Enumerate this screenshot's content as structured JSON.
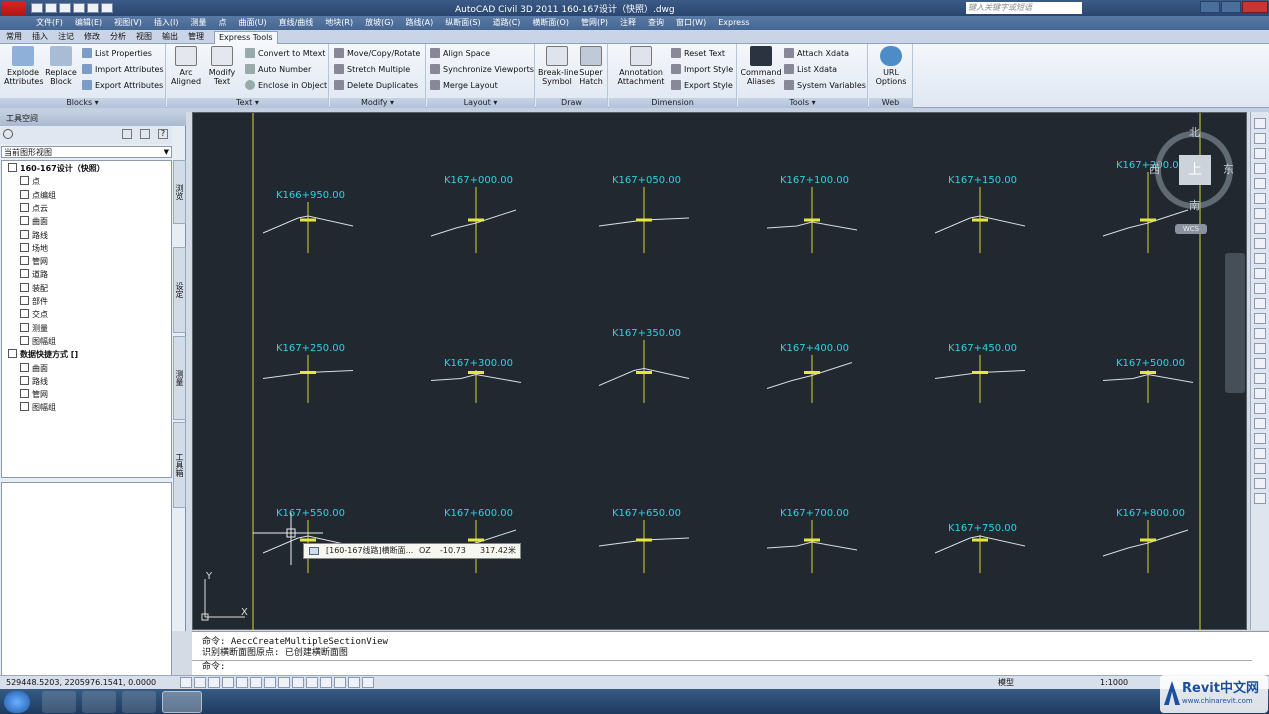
{
  "titlebar": {
    "title": "AutoCAD Civil 3D 2011    160-167设计（快照）.dwg",
    "search_placeholder": "键入关键字或短语"
  },
  "menubar": {
    "items": [
      "文件(F)",
      "编辑(E)",
      "视图(V)",
      "插入(I)",
      "测量",
      "点",
      "曲面(U)",
      "直线/曲线",
      "地块(R)",
      "放坡(G)",
      "路线(A)",
      "纵断面(S)",
      "道路(C)",
      "横断面(O)",
      "管网(P)",
      "注释",
      "查询",
      "窗口(W)",
      "Express"
    ]
  },
  "ribbon_tabs": {
    "items": [
      "常用",
      "插入",
      "注记",
      "修改",
      "分析",
      "视图",
      "输出",
      "管理",
      "Express Tools"
    ],
    "active": "Express Tools"
  },
  "ribbon": {
    "blocks": {
      "footer": "Blocks ▾",
      "explode": "Explode\nAttributes",
      "replace": "Replace\nBlock",
      "list_props": "List Properties",
      "import_attr": "Import Attributes",
      "export_attr": "Export Attributes"
    },
    "text": {
      "footer": "Text ▾",
      "arc": "Arc\nAligned",
      "modify": "Modify\nText",
      "convert": "Convert to Mtext",
      "auto_number": "Auto Number",
      "enclose": "Enclose in Object"
    },
    "modify": {
      "footer": "Modify ▾",
      "move_copy": "Move/Copy/Rotate",
      "stretch": "Stretch Multiple",
      "delete_dup": "Delete Duplicates"
    },
    "layout": {
      "footer": "Layout ▾",
      "align_space": "Align Space",
      "sync_viewports": "Synchronize Viewports",
      "merge_layout": "Merge Layout"
    },
    "draw": {
      "footer": "Draw",
      "breakline": "Break-line\nSymbol",
      "super_hatch": "Super\nHatch"
    },
    "dimension": {
      "footer": "Dimension",
      "annotation": "Annotation\nAttachment",
      "reset_text": "Reset Text",
      "import_style": "Import Style",
      "export_style": "Export Style"
    },
    "tools": {
      "footer": "Tools ▾",
      "cmd_aliases": "Command\nAliases",
      "attach_xdata": "Attach Xdata",
      "list_xdata": "List Xdata",
      "sys_vars": "System Variables"
    },
    "web": {
      "footer": "Web",
      "url_options": "URL\nOptions"
    }
  },
  "leftpanel": {
    "title": "工具空间",
    "dropdown": "当前图形视图",
    "tree": [
      {
        "label": "160-167设计（快照）",
        "level": 0
      },
      {
        "label": "点",
        "level": 1
      },
      {
        "label": "点编组",
        "level": 1
      },
      {
        "label": "点云",
        "level": 1
      },
      {
        "label": "曲面",
        "level": 1
      },
      {
        "label": "路线",
        "level": 1
      },
      {
        "label": "场地",
        "level": 1
      },
      {
        "label": "管网",
        "level": 1
      },
      {
        "label": "道路",
        "level": 1
      },
      {
        "label": "装配",
        "level": 1
      },
      {
        "label": "部件",
        "level": 1
      },
      {
        "label": "交点",
        "level": 1
      },
      {
        "label": "测量",
        "level": 1
      },
      {
        "label": "图幅组",
        "level": 1
      },
      {
        "label": "数据快捷方式 []",
        "level": 0
      },
      {
        "label": "曲面",
        "level": 1
      },
      {
        "label": "路线",
        "level": 1
      },
      {
        "label": "管网",
        "level": 1
      },
      {
        "label": "图幅组",
        "level": 1
      }
    ],
    "vtabs": [
      "浏览",
      "设定",
      "测量",
      "工具箱"
    ]
  },
  "canvas": {
    "stations": [
      "K166+950.00",
      "K167+000.00",
      "K167+050.00",
      "K167+100.00",
      "K167+150.00",
      "K167+200.00",
      "K167+250.00",
      "K167+300.00",
      "K167+350.00",
      "K167+400.00",
      "K167+450.00",
      "K167+500.00",
      "K167+550.00",
      "K167+600.00",
      "K167+650.00",
      "K167+700.00",
      "K167+750.00",
      "K167+800.00"
    ],
    "tooltip": {
      "name": "[160-167线路]横断面...",
      "label": "OZ",
      "value1": "-10.73",
      "value2": "317.42米"
    },
    "viewcube": {
      "north": "北",
      "south": "南",
      "east": "东",
      "west": "西",
      "top": "上",
      "wcs": "WCS"
    },
    "ucs_y": "Y",
    "ucs_x": "X"
  },
  "command": {
    "line1": "命令:  AeccCreateMultipleSectionView",
    "line2": "识别横断面图原点: 已创建横断面图",
    "prompt": "命令:"
  },
  "statusbar": {
    "coords": "529448.5203, 2205976.1541, 0.0000",
    "model": "模型",
    "scale": "1:1000"
  },
  "taskbar": {
    "clock": "",
    "watermark": "Revit中文网",
    "watermark_url": "www.chinarevit.com"
  }
}
